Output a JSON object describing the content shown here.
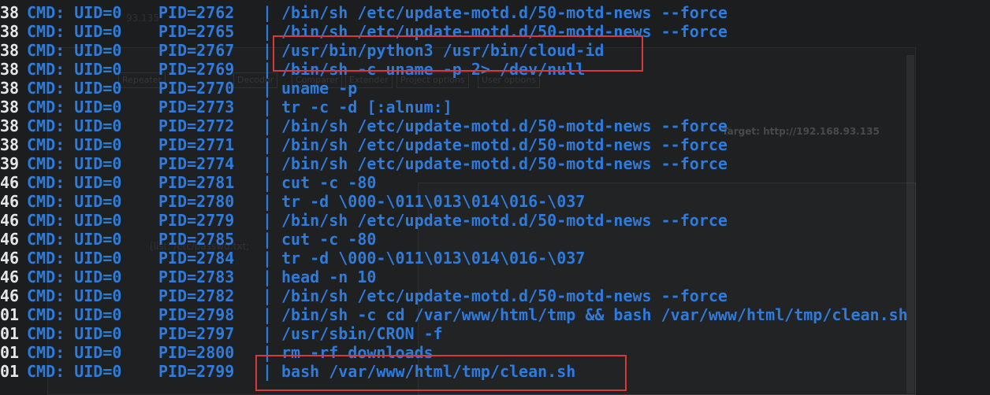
{
  "background_window": {
    "target_label": "Target: http://192.168.93.135",
    "title_fragment": "93.135",
    "tabs": [
      "Repeater",
      "Decoder",
      "Comparer",
      "Extender",
      "Project options",
      "User options"
    ],
    "body_text": "[list: /etc/passwd.txt;"
  },
  "terminal": {
    "rows": [
      {
        "ts": "38",
        "uid": "CMD: UID=0",
        "pid": "PID=2762",
        "sep": "|",
        "cmd": "/bin/sh /etc/update-motd.d/50-motd-news --force"
      },
      {
        "ts": "38",
        "uid": "CMD: UID=0",
        "pid": "PID=2765",
        "sep": "|",
        "cmd": "/bin/sh /etc/update-motd.d/50-motd-news --force"
      },
      {
        "ts": "38",
        "uid": "CMD: UID=0",
        "pid": "PID=2767",
        "sep": "|",
        "cmd": "/usr/bin/python3 /usr/bin/cloud-id"
      },
      {
        "ts": "38",
        "uid": "CMD: UID=0",
        "pid": "PID=2769",
        "sep": "|",
        "cmd": "/bin/sh -c uname -p 2> /dev/null"
      },
      {
        "ts": "38",
        "uid": "CMD: UID=0",
        "pid": "PID=2770",
        "sep": "|",
        "cmd": "uname -p"
      },
      {
        "ts": "38",
        "uid": "CMD: UID=0",
        "pid": "PID=2773",
        "sep": "|",
        "cmd": "tr -c -d [:alnum:]"
      },
      {
        "ts": "38",
        "uid": "CMD: UID=0",
        "pid": "PID=2772",
        "sep": "|",
        "cmd": "/bin/sh /etc/update-motd.d/50-motd-news --force"
      },
      {
        "ts": "38",
        "uid": "CMD: UID=0",
        "pid": "PID=2771",
        "sep": "|",
        "cmd": "/bin/sh /etc/update-motd.d/50-motd-news --force"
      },
      {
        "ts": "39",
        "uid": "CMD: UID=0",
        "pid": "PID=2774",
        "sep": "|",
        "cmd": "/bin/sh /etc/update-motd.d/50-motd-news --force"
      },
      {
        "ts": "46",
        "uid": "CMD: UID=0",
        "pid": "PID=2781",
        "sep": "|",
        "cmd": "cut -c -80"
      },
      {
        "ts": "46",
        "uid": "CMD: UID=0",
        "pid": "PID=2780",
        "sep": "|",
        "cmd": "tr -d \\000-\\011\\013\\014\\016-\\037"
      },
      {
        "ts": "46",
        "uid": "CMD: UID=0",
        "pid": "PID=2779",
        "sep": "|",
        "cmd": "/bin/sh /etc/update-motd.d/50-motd-news --force"
      },
      {
        "ts": "46",
        "uid": "CMD: UID=0",
        "pid": "PID=2785",
        "sep": "|",
        "cmd": "cut -c -80"
      },
      {
        "ts": "46",
        "uid": "CMD: UID=0",
        "pid": "PID=2784",
        "sep": "|",
        "cmd": "tr -d \\000-\\011\\013\\014\\016-\\037"
      },
      {
        "ts": "46",
        "uid": "CMD: UID=0",
        "pid": "PID=2783",
        "sep": "|",
        "cmd": "head -n 10"
      },
      {
        "ts": "46",
        "uid": "CMD: UID=0",
        "pid": "PID=2782",
        "sep": "|",
        "cmd": "/bin/sh /etc/update-motd.d/50-motd-news --force"
      },
      {
        "ts": "01",
        "uid": "CMD: UID=0",
        "pid": "PID=2798",
        "sep": "|",
        "cmd": "/bin/sh -c cd /var/www/html/tmp && bash /var/www/html/tmp/clean.sh"
      },
      {
        "ts": "01",
        "uid": "CMD: UID=0",
        "pid": "PID=2797",
        "sep": "|",
        "cmd": "/usr/sbin/CRON -f"
      },
      {
        "ts": "01",
        "uid": "CMD: UID=0",
        "pid": "PID=2800",
        "sep": "|",
        "cmd": "rm -rf downloads"
      },
      {
        "ts": "01",
        "uid": "CMD: UID=0",
        "pid": "PID=2799",
        "sep": "|",
        "cmd": "bash /var/www/html/tmp/clean.sh"
      }
    ]
  },
  "colors": {
    "terminal_background": "#1b1d1f",
    "timestamp": "#e6e6e6",
    "command_text": "#2f7bdc",
    "highlight_box": "#d63a3a"
  }
}
